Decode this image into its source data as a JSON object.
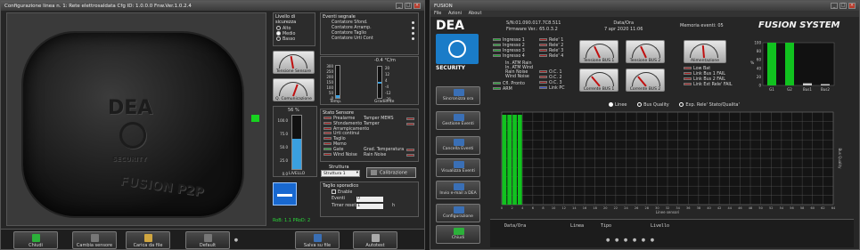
{
  "left_window": {
    "title": "Configurazione linea n. 1: Rete elettrosaldata Cfg ID: 1.0.0.0 Fnw.Ver.1.0.2.4",
    "device_brand": "DEA",
    "device_sub": "SECURITY",
    "device_model": "FUSION P2P",
    "security_level": {
      "title": "Livello di sicurezza",
      "options": [
        "Alto",
        "Medio",
        "Basso"
      ],
      "selected": "Medio"
    },
    "signal_events": {
      "title": "Eventi segnale",
      "items": [
        "Contatore Sfond.",
        "Contatore Arramp.",
        "Contatore Taglio",
        "Contatore Urti Cont"
      ]
    },
    "gauges": [
      "Tensione Sensore",
      "Q. Comunicazione"
    ],
    "temp_readout": "-0.4",
    "temp_unit": "°C/m",
    "temp_scale": [
      "300",
      "250",
      "200",
      "150",
      "100",
      "50",
      "0"
    ],
    "grad_scale": [
      "20",
      "12",
      "4",
      "-4",
      "-12",
      "-20"
    ],
    "temp_label": "Temp.",
    "grad_label": "Gradiente",
    "level": {
      "value_text": "56",
      "unit": "%",
      "fraction": 0.56,
      "scale": [
        "100.0",
        "75.0",
        "50.0",
        "25.0",
        "0.0"
      ],
      "label": "LIVELLO"
    },
    "sensor_states": {
      "title": "Stato Sensore",
      "left": [
        "Prealarme",
        "Sfondamento",
        "Arrampicamento",
        "Urti continui",
        "Taglio",
        "Memo",
        "Gate",
        "Wind Noise"
      ],
      "right": [
        "Tamper MEMS",
        "Tamper",
        "",
        "",
        "",
        "",
        "Grad. Temperatura",
        "Rain Noise"
      ],
      "left_states": [
        "red",
        "red",
        "red",
        "red",
        "red",
        "red",
        "green",
        "red"
      ]
    },
    "structure": {
      "title": "Struttura",
      "value": "Struttura 1",
      "calibrate": "Calibrazione"
    },
    "sporadic": {
      "title": "Taglio sporadico",
      "enable": "Enable",
      "events_label": "Eventi",
      "events_value": "0",
      "timer_label": "Timer reset",
      "timer_value": "1",
      "timer_unit": "h"
    },
    "footer_value": "RoB: 1.1 PRoD: 2",
    "buttons": [
      "Chiudi",
      "Cambia sensore",
      "Carica da file",
      "Default",
      "Salva su file",
      "Autotest"
    ]
  },
  "right_window": {
    "title": "FUSION",
    "menu": [
      "File",
      "Azioni",
      "About"
    ],
    "brand": "DEA",
    "brand_sub": "SECURITY",
    "serial": "S/N:01.090.017.7C8.511",
    "firmware": "Firmware Ver.: 65.0.3.2",
    "date_label": "Data/Ora",
    "date_value": "7 apr 2020 11:06",
    "memory_label": "Memoria eventi:",
    "memory_value": "05",
    "system_name": "FUSION SYSTEM",
    "inputs": [
      "Ingresso 1",
      "Ingresso 2",
      "Ingresso 3",
      "Ingresso 4"
    ],
    "relays": [
      "Rele' 1",
      "Rele' 2",
      "Rele' 3",
      "Rele' 4"
    ],
    "status_left": [
      "In. ATM Rain",
      "In. ATM Wind",
      "Rain Noise",
      "Wind Noise"
    ],
    "status_left2": [
      "Cfl. Pronto",
      "ARM"
    ],
    "oc": [
      "O.C. 1",
      "O.C. 2",
      "O.C. 3",
      "Link PC"
    ],
    "bus_gauges": [
      "Tensione BUS 1",
      "Tensione BUS 2",
      "Corrente BUS 1",
      "Corrente BUS 2"
    ],
    "supply_gauge": "Alimentazione",
    "faults": [
      "Low Bat",
      "Link Bus 1 FAIL",
      "Link Bus 2 FAIL",
      "Link Ext Rele' FAIL"
    ],
    "side_buttons": [
      "Sincronizza ora",
      "Gestione Eventi",
      "Cancella Eventi",
      "Visualizza Eventi",
      "Invio e-mail a DEA",
      "Configurazione",
      "Chiudi"
    ],
    "radio_options": [
      "Linee",
      "Bus Quality",
      "Exp. Rele' Stato/Qualita'"
    ],
    "selected_radio": "Linee",
    "event_headers": [
      "Data/Ora",
      "Linea",
      "Tipo",
      "Livello"
    ],
    "chart_xlabel": "Linee sensori",
    "chart_ylabel": "Bus Quality"
  },
  "chart_data": [
    {
      "type": "bar",
      "categories": [
        "G1",
        "G2",
        "Bus1",
        "Bus2"
      ],
      "values": [
        100,
        100,
        5,
        3
      ],
      "ylim": [
        0,
        100
      ],
      "ylabel": "%",
      "yticks": [
        "100",
        "80",
        "60",
        "40",
        "20",
        "0"
      ],
      "colors": [
        "#11c21f",
        "#11c21f",
        "#cccccc",
        "#cccccc"
      ]
    },
    {
      "type": "bar",
      "xlabel": "Linee sensori",
      "ylabel": "Bus Quality",
      "x": [
        1,
        2,
        3,
        4
      ],
      "values": [
        100,
        100,
        100,
        100
      ],
      "xlim": [
        0,
        64
      ],
      "xticks": [
        "0",
        "2",
        "4",
        "6",
        "8",
        "10",
        "12",
        "14",
        "16",
        "18",
        "20",
        "22",
        "24",
        "26",
        "28",
        "30",
        "32",
        "34",
        "36",
        "38",
        "40",
        "42",
        "44",
        "46",
        "48",
        "50",
        "52",
        "54",
        "56",
        "58",
        "60",
        "62",
        "64"
      ],
      "ylim": [
        0,
        100
      ],
      "grid": true,
      "color": "#11c21f"
    }
  ]
}
